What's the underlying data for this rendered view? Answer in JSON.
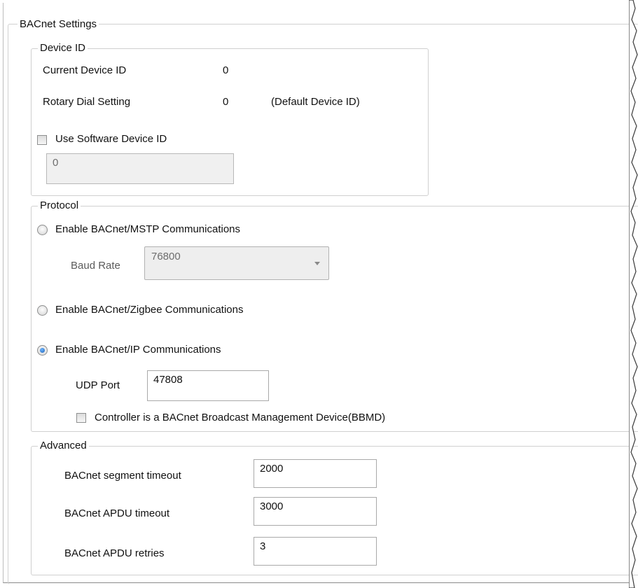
{
  "settings": {
    "title": "BACnet Settings",
    "device_id": {
      "legend": "Device ID",
      "current_label": "Current Device ID",
      "current_value": "0",
      "rotary_label": "Rotary Dial Setting",
      "rotary_value": "0",
      "rotary_note": "(Default Device ID)",
      "use_software_label": "Use Software Device ID",
      "use_software_checked": false,
      "software_id_value": "0"
    },
    "protocol": {
      "legend": "Protocol",
      "mstp_label": "Enable BACnet/MSTP Communications",
      "baud_label": "Baud Rate",
      "baud_value": "76800",
      "zigbee_label": "Enable BACnet/Zigbee Communications",
      "ip_label": "Enable BACnet/IP Communications",
      "selected": "Enable BACnet/IP Communications",
      "udp_label": "UDP Port",
      "udp_value": "47808",
      "bbmd_label": "Controller is a BACnet Broadcast Management Device(BBMD)",
      "bbmd_checked": false
    },
    "advanced": {
      "legend": "Advanced",
      "segment_label": "BACnet segment timeout",
      "segment_value": "2000",
      "apdu_timeout_label": "BACnet APDU timeout",
      "apdu_timeout_value": "3000",
      "apdu_retries_label": "BACnet APDU retries",
      "apdu_retries_value": "3"
    }
  }
}
